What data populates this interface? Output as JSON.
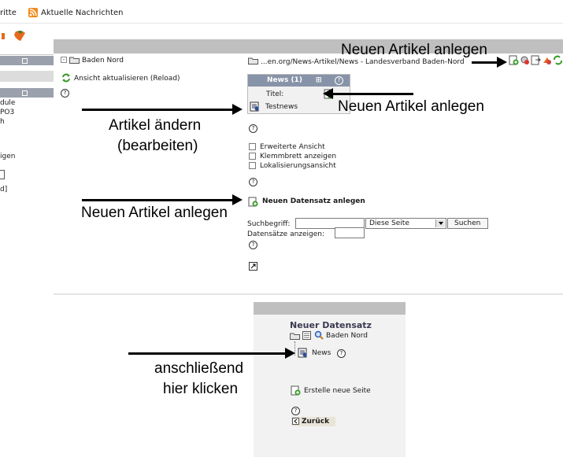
{
  "topbar": {
    "cut_label": "ritte",
    "rss_label": "Aktuelle Nachrichten"
  },
  "sidebar_left": {
    "lines": [
      "dule",
      "PO3",
      "h",
      "igen",
      "d]"
    ]
  },
  "tree": {
    "node": "Baden Nord",
    "reload": "Ansicht aktualisieren (Reload)"
  },
  "path": {
    "text": "...en.org/News-Artikel/News - Landesverband Baden-Nord"
  },
  "context_menu": {
    "title": "News (1)",
    "col_title": "Titel:",
    "record": "Testnews"
  },
  "options": {
    "extended": "Erweiterte Ansicht",
    "clipboard": "Klemmbrett anzeigen",
    "localization": "Lokalisierungsansicht"
  },
  "new_record": {
    "label": "Neuen Datensatz anlegen"
  },
  "search": {
    "label": "Suchbegriff:",
    "value": "",
    "scope": "Diese Seite",
    "button": "Suchen",
    "show_label": "Datensätze anzeigen:",
    "show_value": ""
  },
  "panel2": {
    "title": "Neuer Datensatz",
    "page": "Baden Nord",
    "item": "News",
    "create_page": "Erstelle neue Seite",
    "back": "Zurück"
  },
  "annotations": {
    "a1": "Neuen Artikel anlegen",
    "a2": "Neuen Artikel anlegen",
    "a3_line1": "Artikel ändern",
    "a3_line2": "(bearbeiten)",
    "a4": "Neuen Artikel anlegen",
    "a5_line1": "anschließend",
    "a5_line2": "hier klicken"
  },
  "colors": {
    "header_bar": "#bfbfbf",
    "sidebar": "#dcdcdc",
    "sidebar_btn": "#9aa1ad",
    "menu_header": "#8793a8",
    "menu_bg": "#f1f1f1",
    "panel_bg": "#f2f2f2"
  }
}
